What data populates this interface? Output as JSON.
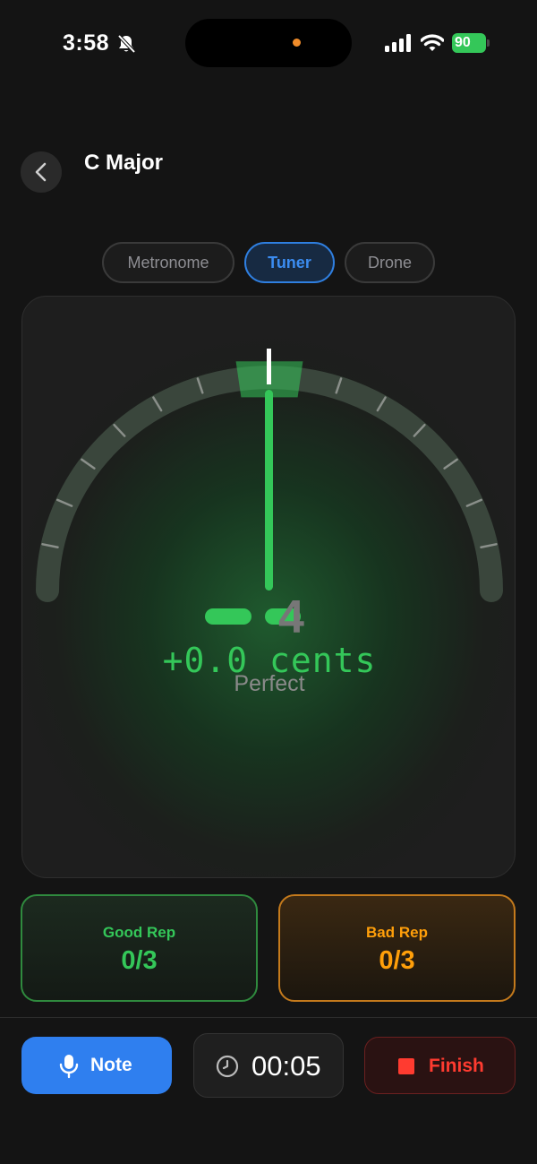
{
  "status_bar": {
    "time": "3:58",
    "battery": "90",
    "icons": [
      "bell-slash-icon",
      "signal-icon",
      "wifi-icon",
      "battery-charging-icon"
    ]
  },
  "header": {
    "back_icon": "chevron-left-icon",
    "title": "C Major"
  },
  "tabs": [
    {
      "label": "Metronome",
      "active": false
    },
    {
      "label": "Tuner",
      "active": true
    },
    {
      "label": "Drone",
      "active": false
    }
  ],
  "tuner": {
    "cents_text": "+0.0 cents",
    "status": "Perfect",
    "note_number": "4",
    "cents_offset": 0,
    "accent_color": "#34c759"
  },
  "reps": {
    "good": {
      "label": "Good Rep",
      "value": "0/3",
      "color": "#34c759"
    },
    "bad": {
      "label": "Bad Rep",
      "value": "0/3",
      "color": "#ff9f0a"
    }
  },
  "toolbar": {
    "note_label": "Note",
    "note_icon": "microphone-icon",
    "timer": "00:05",
    "timer_icon": "clock-icon",
    "finish_label": "Finish",
    "finish_icon": "stop-icon",
    "note_color": "#2f7fef",
    "finish_color": "#ff3b30"
  }
}
